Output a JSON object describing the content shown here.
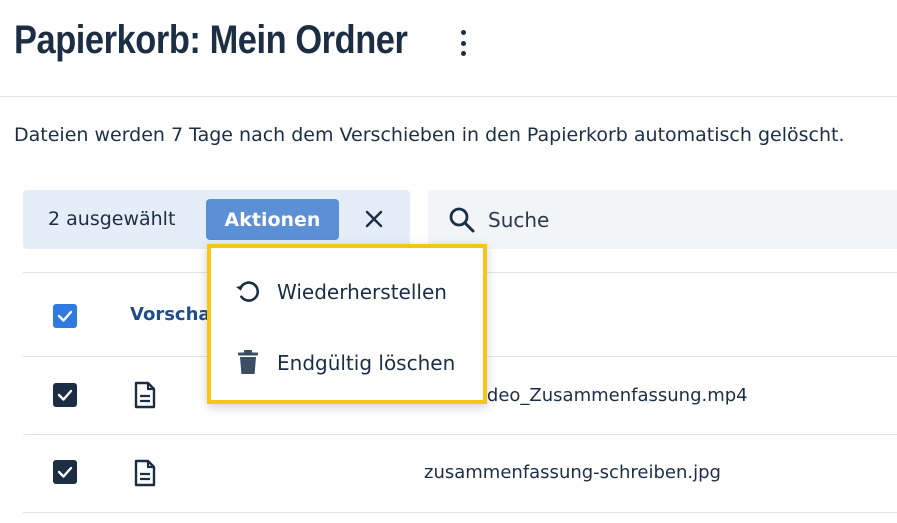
{
  "header": {
    "title": "Papierkorb: Mein Ordner",
    "more_icon": "kebab-vertical-icon"
  },
  "info_text": "Dateien werden 7 Tage nach dem Verschieben in den Papierkorb automatisch gelöscht.",
  "selection_bar": {
    "count_label": "2 ausgewählt",
    "actions_label": "Aktionen",
    "close_icon": "close-icon"
  },
  "search": {
    "placeholder": "Suche",
    "icon": "search-icon"
  },
  "table": {
    "column_preview": "Vorschau",
    "rows": [
      {
        "name": "Video_Zusammenfassung.mp4",
        "checked": true,
        "icon": "file-icon"
      },
      {
        "name": "zusammenfassung-schreiben.jpg",
        "checked": true,
        "icon": "file-icon"
      }
    ]
  },
  "actions_menu": {
    "items": [
      {
        "label": "Wiederherstellen",
        "icon": "restore-icon"
      },
      {
        "label": "Endgültig löschen",
        "icon": "trash-icon"
      }
    ]
  },
  "colors": {
    "accent": "#5b8fd6",
    "checkbox_header": "#2f7be0",
    "checkbox_row": "#1c2e44",
    "selection_bg": "#e5eef8",
    "highlight": "#f5c518"
  }
}
